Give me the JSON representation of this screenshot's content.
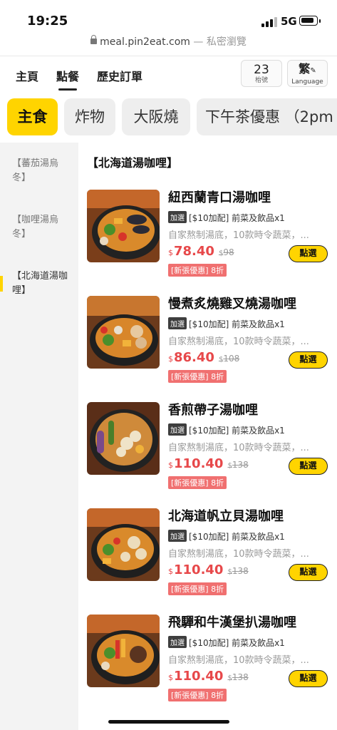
{
  "status_bar": {
    "time": "19:25",
    "network": "5G"
  },
  "url_bar": {
    "domain": "meal.pin2eat.com",
    "mode": "— 私密瀏覽"
  },
  "top_nav": {
    "tabs": [
      {
        "label": "主頁",
        "active": false
      },
      {
        "label": "點餐",
        "active": true
      },
      {
        "label": "歷史訂單",
        "active": false
      }
    ],
    "seat": {
      "number": "23",
      "label": "枱號"
    },
    "language": {
      "current": "繁",
      "label": "Language"
    }
  },
  "categories": [
    {
      "label": "主食",
      "active": true
    },
    {
      "label": "炸物",
      "active": false
    },
    {
      "label": "大阪燒",
      "active": false
    },
    {
      "label": "下午茶優惠 （2pm",
      "active": false
    }
  ],
  "sidebar": {
    "items": [
      {
        "label": "【蕃茄湯烏冬】",
        "active": false
      },
      {
        "label": "【咖哩湯烏冬】",
        "active": false
      },
      {
        "label": "【北海道湯咖哩】",
        "active": true
      }
    ]
  },
  "section_title": "【北海道湯咖哩】",
  "menu_items": [
    {
      "name": "紐西蘭青口湯咖哩",
      "addon_tag": "加選",
      "addon": "[$10加配] 前菜及飲品x1",
      "description": "自家熬制湯底，10款時令蔬菜，...",
      "currency": "$",
      "price": "78.40",
      "original_price": "98",
      "promo": "[新張優惠] 8折",
      "button": "點選"
    },
    {
      "name": "慢煮炙燒雞叉燒湯咖哩",
      "addon_tag": "加選",
      "addon": "[$10加配] 前菜及飲品x1",
      "description": "自家熬制湯底，10款時令蔬菜，...",
      "currency": "$",
      "price": "86.40",
      "original_price": "108",
      "promo": "[新張優惠] 8折",
      "button": "點選"
    },
    {
      "name": "香煎帶子湯咖哩",
      "addon_tag": "加選",
      "addon": "[$10加配] 前菜及飲品x1",
      "description": "自家熬制湯底，10款時令蔬菜，...",
      "currency": "$",
      "price": "110.40",
      "original_price": "138",
      "promo": "[新張優惠] 8折",
      "button": "點選"
    },
    {
      "name": "北海道帆立貝湯咖哩",
      "addon_tag": "加選",
      "addon": "[$10加配] 前菜及飲品x1",
      "description": "自家熬制湯底，10款時令蔬菜，...",
      "currency": "$",
      "price": "110.40",
      "original_price": "138",
      "promo": "[新張優惠] 8折",
      "button": "點選"
    },
    {
      "name": "飛驒和牛漢堡扒湯咖哩",
      "addon_tag": "加選",
      "addon": "[$10加配] 前菜及飲品x1",
      "description": "自家熬制湯底，10款時令蔬菜，...",
      "currency": "$",
      "price": "110.40",
      "original_price": "138",
      "promo": "[新張優惠] 8折",
      "button": "點選"
    }
  ],
  "colors": {
    "accent": "#ffd400",
    "price": "#e7484a",
    "promo_bg": "#f07070"
  }
}
